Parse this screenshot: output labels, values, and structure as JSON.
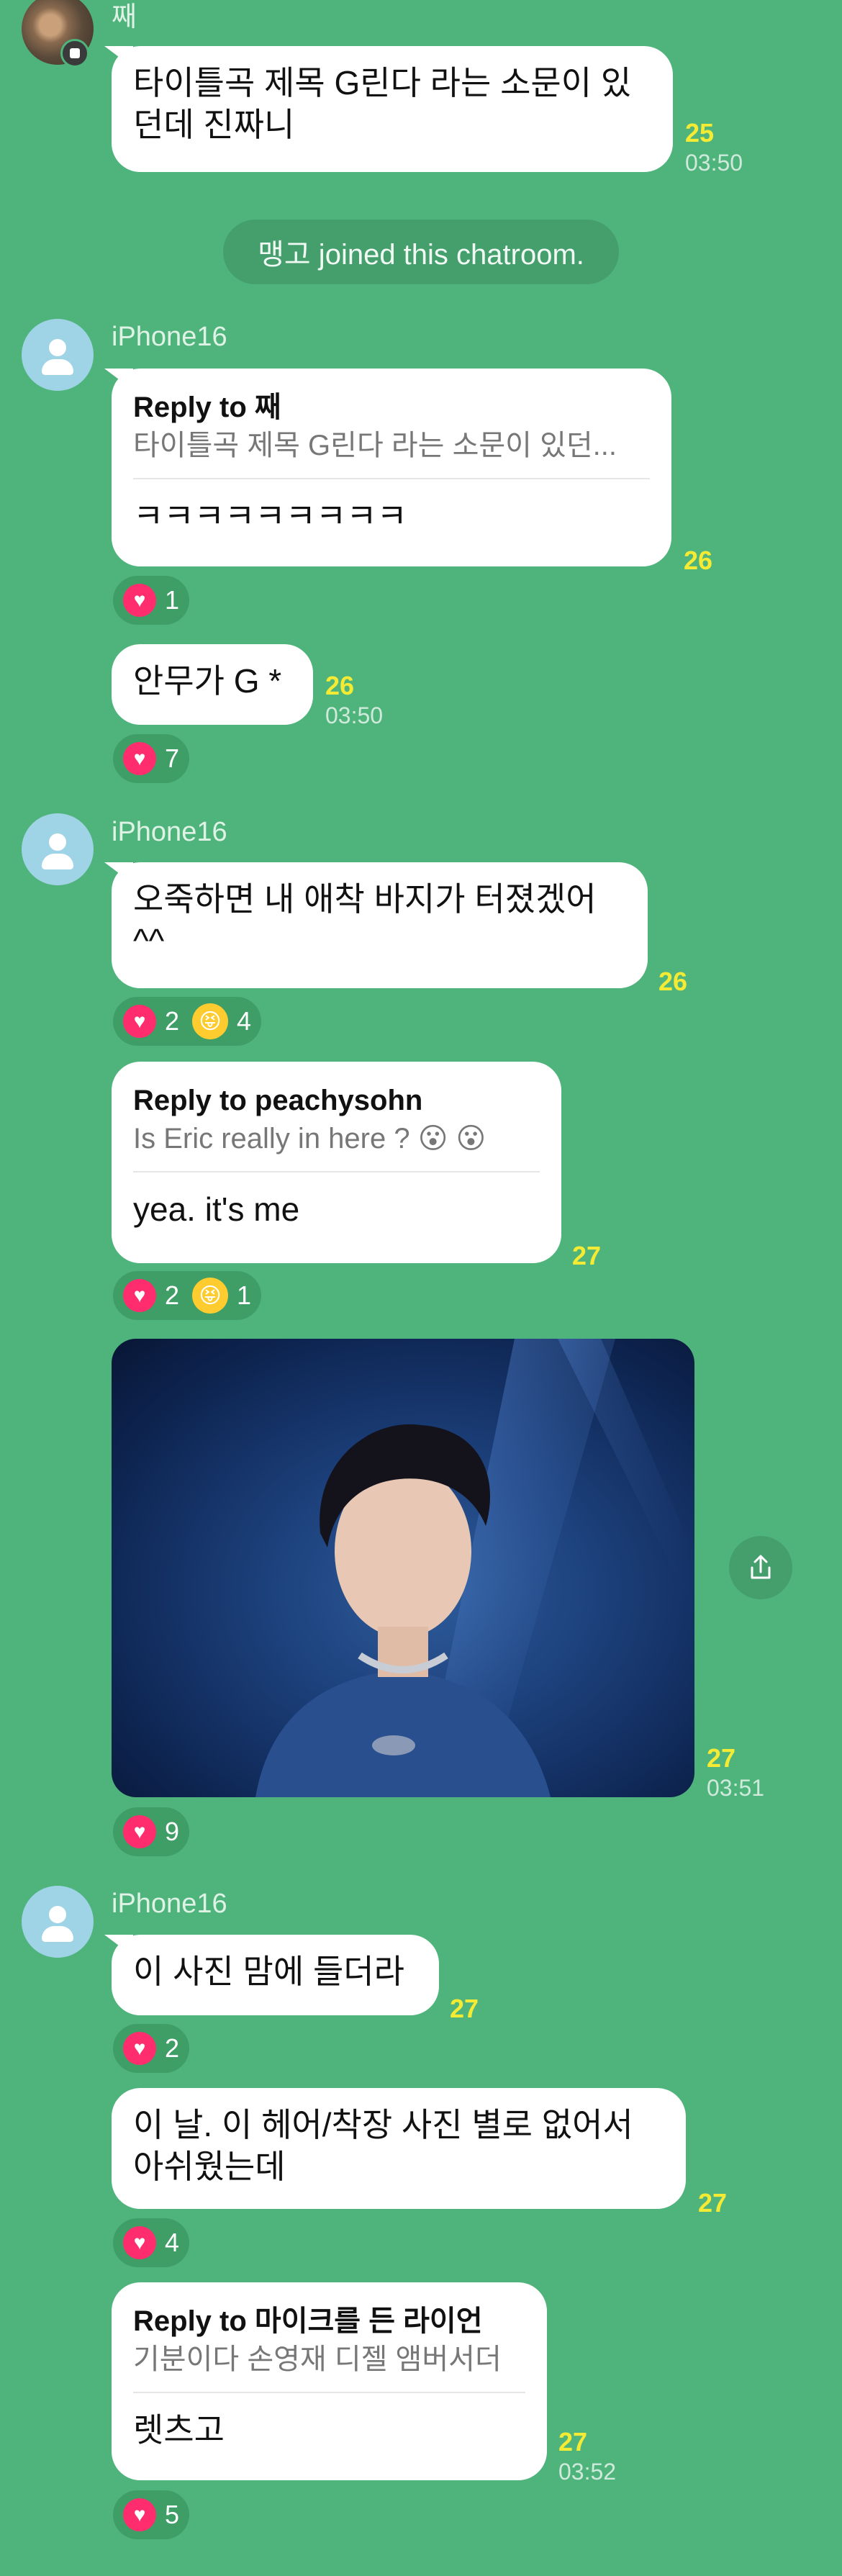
{
  "messages": {
    "m1": {
      "sender": "째",
      "text": "타이틀곡 제목 G린다 라는 소문이 있던데 진짜니",
      "read_count": "25",
      "time": "03:50"
    },
    "system": {
      "text": "맹고  joined this chatroom."
    },
    "m2": {
      "sender": "iPhone16",
      "reply_label": "Reply to 째",
      "quote": "타이틀곡 제목 G린다 라는 소문이 있던...",
      "text": "ㅋㅋㅋㅋㅋㅋㅋㅋㅋ",
      "read_count": "26",
      "heart": "1"
    },
    "m3": {
      "text": "안무가 G *",
      "read_count": "26",
      "time": "03:50",
      "heart": "7"
    },
    "m4": {
      "sender": "iPhone16",
      "text": "오죽하면 내 애착 바지가 터졌겠어 ^^",
      "read_count": "26",
      "heart": "2",
      "grin": "4"
    },
    "m5": {
      "reply_label": "Reply to peachysohn",
      "quote": "Is Eric really in here ? 😮 😮",
      "text": "yea. it's me",
      "read_count": "27",
      "heart": "2",
      "grin": "1"
    },
    "m6": {
      "image": "photo of performer on blue-lit stage",
      "read_count": "27",
      "time": "03:51",
      "heart": "9"
    },
    "m7": {
      "sender": "iPhone16",
      "text": "이 사진 맘에 들더라",
      "read_count": "27",
      "heart": "2"
    },
    "m8": {
      "text": "이 날. 이 헤어/착장 사진 별로 없어서 아쉬웠는데",
      "read_count": "27",
      "heart": "4"
    },
    "m9": {
      "reply_label": "Reply to 마이크를 든 라이언",
      "quote": "기분이다 손영재 디젤 앰버서더",
      "text": "렛츠고",
      "read_count": "27",
      "time": "03:52",
      "heart": "5"
    }
  },
  "icons": {
    "heart": "heart-icon",
    "grin": "grinning-squint-tongue-emoji",
    "share": "share-icon",
    "avatar": "default-avatar-icon"
  },
  "colors": {
    "background": "#4fb47c",
    "read_count": "#f5ea34",
    "heart": "#ff2d6e",
    "reaction_pill": "#3e9e66"
  }
}
